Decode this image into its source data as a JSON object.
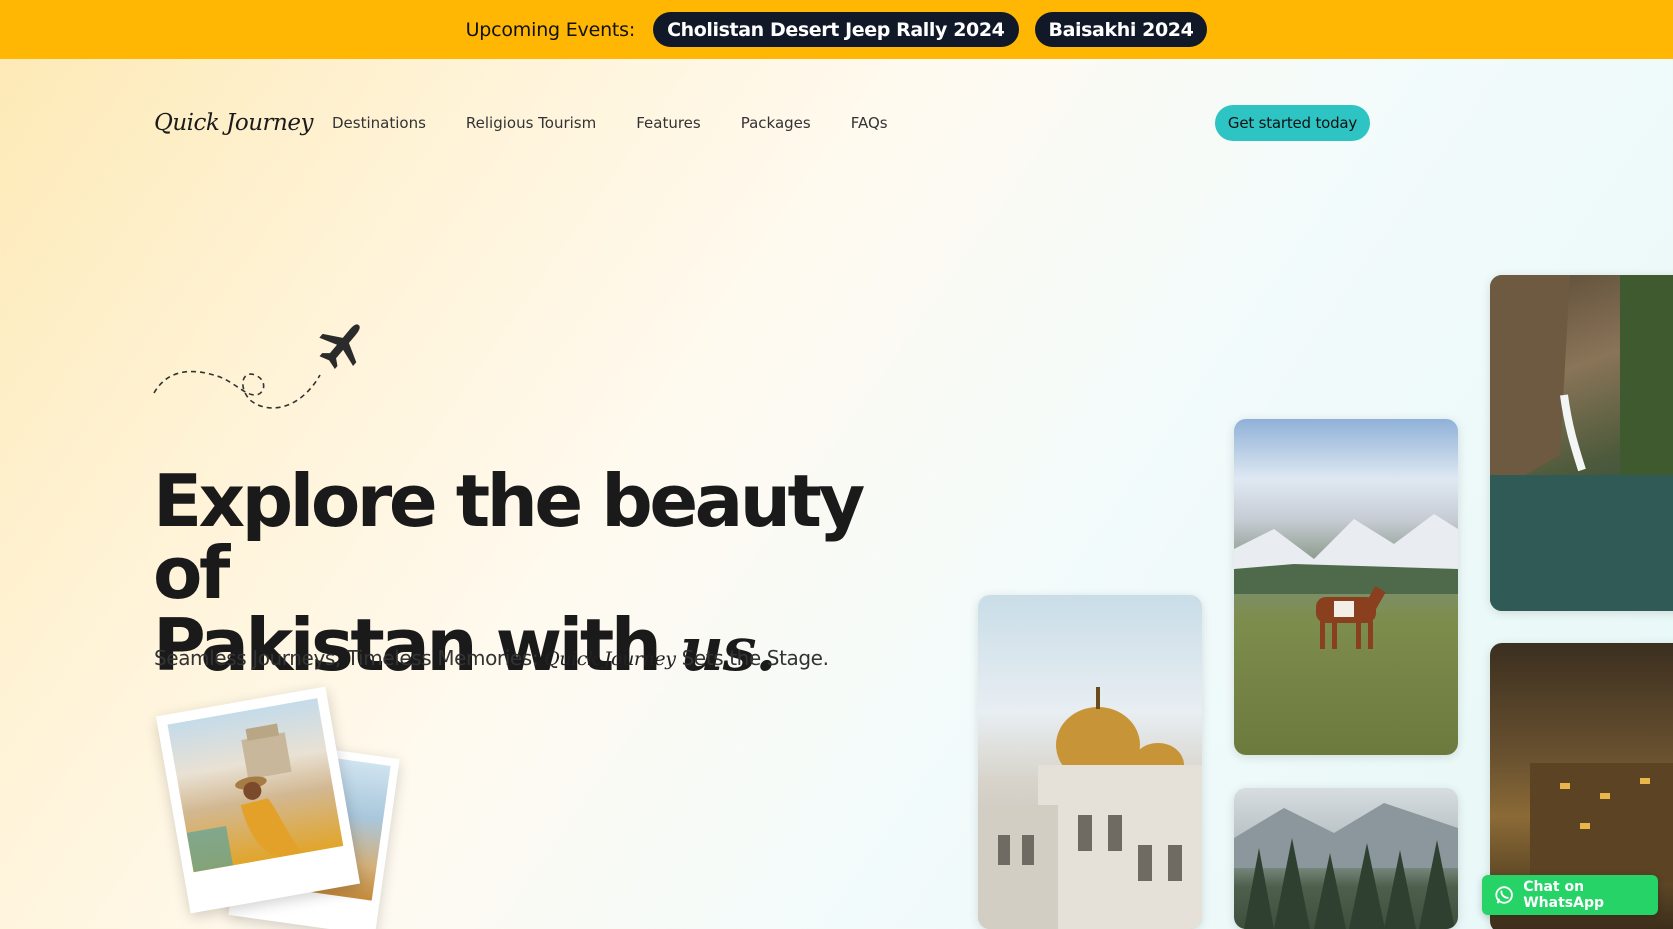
{
  "events": {
    "label": "Upcoming Events:",
    "items": [
      "Cholistan Desert Jeep Rally 2024",
      "Baisakhi 2024"
    ]
  },
  "nav": {
    "logo": "Quick Journey",
    "links": [
      "Destinations",
      "Religious Tourism",
      "Features",
      "Packages",
      "FAQs"
    ],
    "cta": "Get started today"
  },
  "hero": {
    "headline_part1": "Explore the beauty of",
    "headline_part2": "Pakistan with",
    "headline_script": "us.",
    "subline_before": "Seamless Journeys, Timeless Memories:",
    "subline_brand": "Quick Journey",
    "subline_after": "Sets the Stage."
  },
  "whatsapp": {
    "label": "Chat on WhatsApp"
  },
  "colors": {
    "banner": "#ffb703",
    "pill": "#111827",
    "cta": "#2ec4c4",
    "whatsapp": "#25d366"
  },
  "icons": [
    "airplane-icon",
    "whatsapp-icon"
  ]
}
